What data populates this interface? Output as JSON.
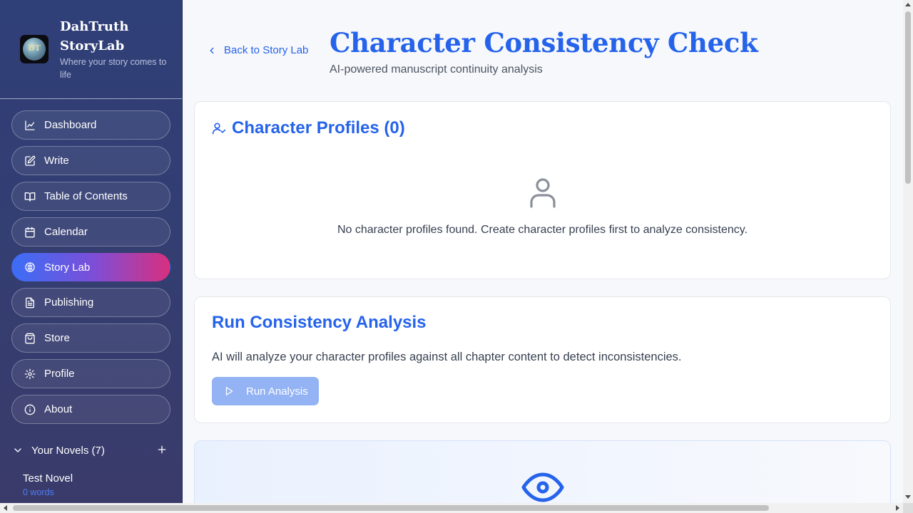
{
  "brand": {
    "name": "DahTruth StoryLab",
    "tagline": "Where your story comes to life",
    "logo_text": "DT"
  },
  "sidebar": {
    "items": [
      {
        "label": "Dashboard",
        "icon": "chart-line-icon"
      },
      {
        "label": "Write",
        "icon": "pencil-square-icon"
      },
      {
        "label": "Table of Contents",
        "icon": "book-open-icon"
      },
      {
        "label": "Calendar",
        "icon": "calendar-icon"
      },
      {
        "label": "Story Lab",
        "icon": "brain-icon",
        "active": true
      },
      {
        "label": "Publishing",
        "icon": "document-icon"
      },
      {
        "label": "Store",
        "icon": "shopping-bag-icon"
      },
      {
        "label": "Profile",
        "icon": "gear-icon"
      },
      {
        "label": "About",
        "icon": "info-icon"
      }
    ],
    "novels": {
      "header": "Your Novels (7)",
      "list": [
        {
          "title": "Test Novel",
          "words": "0 words"
        }
      ]
    }
  },
  "header": {
    "back_label": "Back to Story Lab",
    "title": "Character Consistency Check",
    "subtitle": "AI-powered manuscript continuity analysis"
  },
  "profiles": {
    "title": "Character Profiles (0)",
    "empty_message": "No character profiles found. Create character profiles first to analyze consistency."
  },
  "analysis": {
    "title": "Run Consistency Analysis",
    "description": "AI will analyze your character profiles against all chapter content to detect inconsistencies.",
    "button_label": "Run Analysis",
    "button_disabled": true
  },
  "colors": {
    "accent": "#2563eb",
    "sidebar_bg": "#333e72",
    "active_gradient": [
      "#3b6ef5",
      "#7a4fd9",
      "#d8307f"
    ],
    "button_disabled": "#93b3f5"
  }
}
